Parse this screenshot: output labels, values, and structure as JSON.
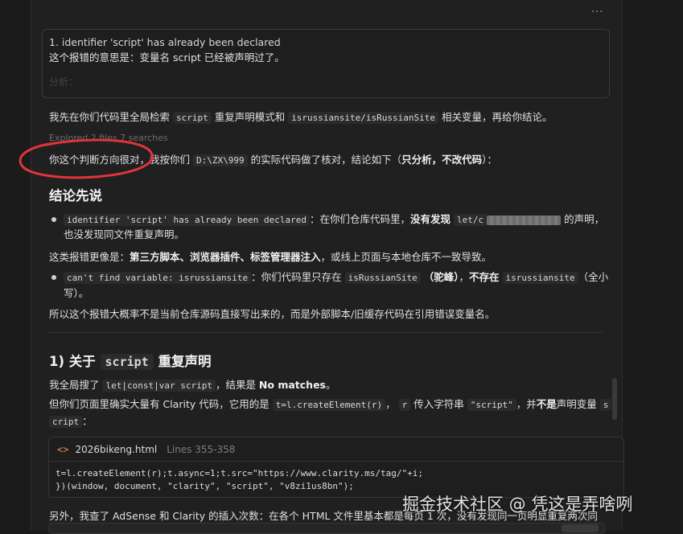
{
  "toolbar": {
    "more_label": "···"
  },
  "quote": {
    "line1": "1. identifier 'script' has already been declared",
    "line2": "这个报错的意思是：变量名 script 已经被声明过了。",
    "line3": "分析："
  },
  "intro": {
    "t1": "我先在你们代码里全局检索 ",
    "c1": "script",
    "t2": " 重复声明模式和 ",
    "c2": "isrussiansite/isRussianSite",
    "t3": " 相关变量，再给你结论。"
  },
  "explore_label": "Explored 2 files 7 searches",
  "verdict": {
    "t1": "你这个判断方向很对，我按你们 ",
    "c1": "D:\\ZX\\999",
    "t2": " 的实际代码做了核对，结论如下（",
    "b1": "只分析，不改代码",
    "t3": "）："
  },
  "section1_title": "结论先说",
  "bullet1": {
    "c1": "identifier 'script' has already been declared",
    "t1": "：在你们仓库代码里，",
    "b1": "没有发现",
    "c2": "let/c",
    "t2": " 的声明，",
    "t3": "也没发现同文件重复声明。"
  },
  "note1": {
    "t1": "这类报错更像是：",
    "b1": "第三方脚本、浏览器插件、标签管理器注入",
    "t2": "，或线上页面与本地仓库不一致导致。"
  },
  "bullet2": {
    "c1": "can't find variable: isrussiansite",
    "t1": "：你们代码里只存在 ",
    "c2": "isRussianSite",
    "b1": "（驼峰）",
    "t2": "，",
    "b2": "不存在",
    "t3": " ",
    "c3": "isrussiansite",
    "t4": "（全小",
    "t5": "写）。"
  },
  "summary": "所以这个报错大概率不是当前仓库源码直接写出来的，而是外部脚本/旧缓存代码在引用错误变量名。",
  "section2": {
    "t1": "1) 关于 ",
    "c1": "script",
    "t2": " 重复声明"
  },
  "search_result": {
    "t1": "我全局搜了 ",
    "c1": "let|const|var script",
    "t2": "，结果是 ",
    "b1": "No matches",
    "t3": "。"
  },
  "clarity_line": {
    "t1": "但你们页面里确实大量有 Clarity 代码，它用的是 ",
    "c1": "t=l.createElement(r)",
    "t2": "， ",
    "c2": "r",
    "t3": " 传入字符串 ",
    "c3": "\"script\"",
    "t4": "，并",
    "b1": "不是",
    "t5": "声明变量 ",
    "c4": "s",
    "c5": "cript",
    "t6": "："
  },
  "codeblock": {
    "icon": "<>",
    "filename": "2026bikeng.html",
    "lines": "Lines 355-358",
    "code1": "t=l.createElement(r);t.async=1;t.src=\"https://www.clarity.ms/tag/\"+i;",
    "code2": "})(window, document, \"clarity\", \"script\", \"v8zi1us8bn\");"
  },
  "last_line": "另外，我查了 AdSense 和 Clarity 的插入次数：在各个 HTML 文件里基本都是每页 1 次，没有发现同一页明显重复两次同",
  "watermark": "掘金技术社区 @ 凭这是弄啥咧"
}
